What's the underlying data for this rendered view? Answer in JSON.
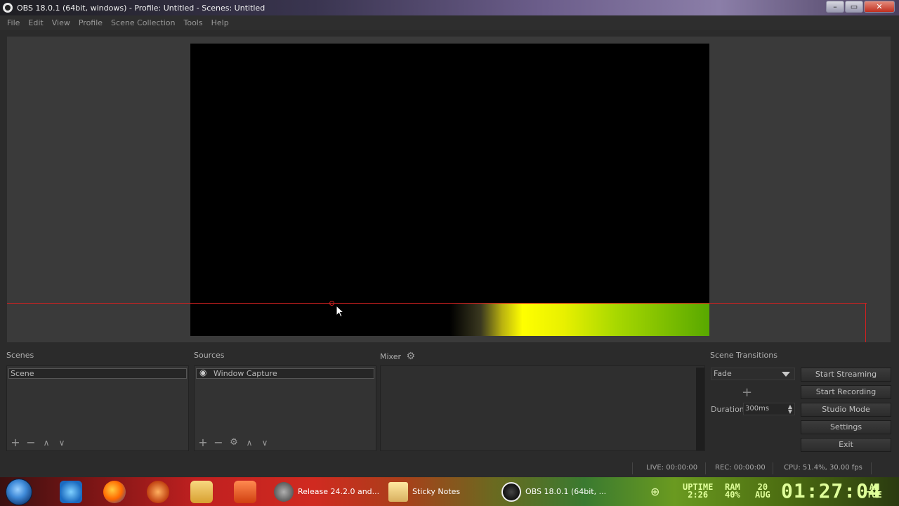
{
  "window": {
    "title": "OBS 18.0.1 (64bit, windows) - Profile: Untitled - Scenes: Untitled",
    "minimize": "–",
    "maximize": "▭",
    "close": "✕"
  },
  "menu": [
    "File",
    "Edit",
    "View",
    "Profile",
    "Scene Collection",
    "Tools",
    "Help"
  ],
  "docks": {
    "scenes": {
      "title": "Scenes",
      "items": [
        "Scene"
      ]
    },
    "sources": {
      "title": "Sources",
      "items": [
        "Window Capture"
      ]
    },
    "mixer": {
      "title": "Mixer"
    },
    "transitions": {
      "title": "Scene Transitions",
      "selected": "Fade",
      "duration_label": "Duration",
      "duration_value": "300ms"
    }
  },
  "controls": {
    "start_streaming": "Start Streaming",
    "start_recording": "Start Recording",
    "studio_mode": "Studio Mode",
    "settings": "Settings",
    "exit": "Exit"
  },
  "status": {
    "live": "LIVE: 00:00:00",
    "rec": "REC: 00:00:00",
    "cpu": "CPU: 51.4%, 30.00 fps"
  },
  "taskbar": {
    "tasks": [
      "Release 24.2.0 and...",
      "Sticky Notes",
      "OBS 18.0.1 (64bit, ..."
    ],
    "uptime_label": "UPTIME",
    "uptime_value": "2:26",
    "ram_label": "RAM",
    "ram_value": "40%",
    "date_day": "20",
    "date_month": "AUG",
    "clock": "01:27:04",
    "ampm": "AM",
    "weekday": "TUE"
  },
  "colors": {
    "accent_red": "#d02020",
    "meter_green": "#58a800",
    "meter_yellow": "#ffff00"
  }
}
